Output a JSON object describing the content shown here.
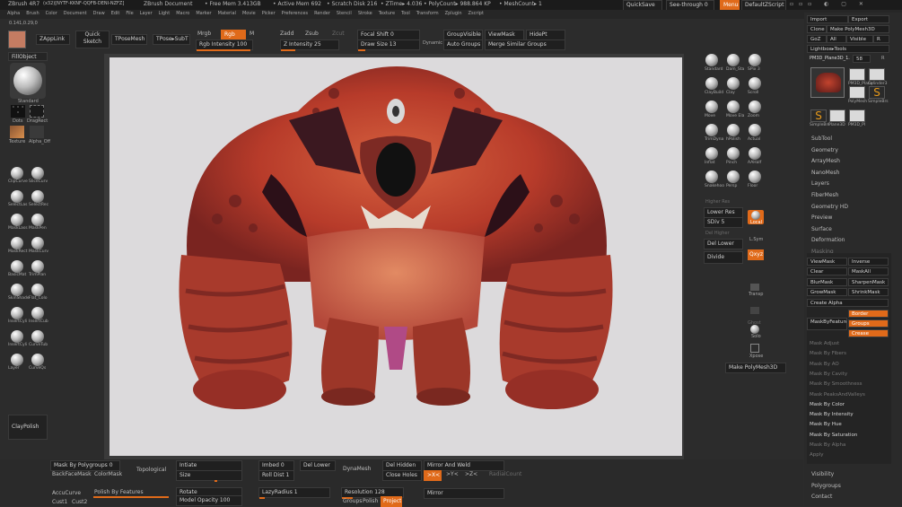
{
  "titlebar": {
    "app": "ZBrush 4R7",
    "build": "(x32)[NYTF-KKNF-QQFB-DENI-NZFZ]",
    "doc": "ZBrush Document",
    "free_mem": "• Free Mem 3.413GB",
    "active_mem": "• Active Mem 692",
    "scratch": "• Scratch Disk 216",
    "ztime": "• ZTime▸ 4.036",
    "polycount": "• PolyCount▸ 988.864 KP",
    "meshcount": "• MeshCount▸ 1",
    "quicksave": "QuickSave",
    "seethrough": "See-through",
    "seethrough_val": "0",
    "menus": "Menus",
    "defaultscript": "DefaultZScript"
  },
  "menubar": [
    "Alpha",
    "Brush",
    "Color",
    "Document",
    "Draw",
    "Edit",
    "File",
    "Layer",
    "Light",
    "Macro",
    "Marker",
    "Material",
    "Movie",
    "Picker",
    "Preferences",
    "Render",
    "Stencil",
    "Stroke",
    "Texture",
    "Tool",
    "Transform",
    "Zplugin",
    "Zscript"
  ],
  "coords": "0.141,0.29,0",
  "toolbar": {
    "zapplink": "ZAppLink",
    "quick_sketch_1": "Quick",
    "quick_sketch_2": "Sketch",
    "tposemesh": "TPoseMesh",
    "tpose_subt": "TPose▸SubT",
    "mrgb": "Mrgb",
    "rgb": "Rgb",
    "m": "M",
    "zadd": "Zadd",
    "zsub": "Zsub",
    "zcut": "Zcut",
    "rgb_intensity": "Rgb Intensity 100",
    "z_intensity": "Z Intensity 25",
    "focal_shift": "Focal Shift 0",
    "draw_size": "Draw Size 13",
    "dynamic": "Dynamic",
    "groupvisible": "GroupVisible",
    "viewmask": "ViewMask",
    "hidept": "HidePt",
    "auto_groups": "Auto Groups",
    "merge_similar": "Merge Similar Groups"
  },
  "left_shelf": {
    "fillobject": "FillObject",
    "standard": "Standard",
    "dots": "Dots",
    "dragrect": "DragRect",
    "texture": "Texture",
    "alpha_off": "Alpha_Off",
    "brushes": [
      "ClipCurve",
      "SliceCurv",
      "SelectLas",
      "SelectRec",
      "MaskLass",
      "MaskPen",
      "MaskRect",
      "MaskCurv",
      "BasicMat",
      "TrimPlan",
      "SkinShade",
      "Flat_Colo",
      "InsertCyli",
      "InsertCub",
      "InsertCyli",
      "CurveTub",
      "Layer",
      "CurveQs"
    ],
    "claypolish": "ClayPolish"
  },
  "right_shelf": {
    "brushes": [
      "Standard",
      "Dam_Sta",
      "SPix 3",
      "ClayBuild",
      "Clay",
      "Scroll",
      "Move",
      "Move Ela",
      "Zoom",
      "TrimDyna",
      "hPolish",
      "Actual",
      "Inflat",
      "Pinch",
      "AAHalf",
      "Snakehoo",
      "Persp",
      "Floor"
    ],
    "higher_res": "Higher Res",
    "lower_res": "Lower Res",
    "sdiv": "SDiv 5",
    "del_higher": "Del Higher",
    "del_lower": "Del Lower",
    "divide": "Divide",
    "local": "Local",
    "lsym": "L.Sym",
    "qxyz": "Qxyz",
    "transp": "Transp",
    "ghost": "Ghost",
    "solo": "Solo",
    "xpose": "Xpose",
    "make_polymesh": "Make PolyMesh3D"
  },
  "tool_panel": {
    "import": "Import",
    "export": "Export",
    "clone": "Clone",
    "make_polymesh": "Make PolyMesh3D",
    "goz": "GoZ",
    "all": "All",
    "visible": "Visible",
    "r": "R",
    "lightbox_tools": "Lightbox▸Tools",
    "current_tool": "PM3D_Plane3D_1.",
    "current_val": "58",
    "tools": [
      "PM3D_Plane",
      "Cylinder3",
      "PolyMesh",
      "SimpleBrs",
      "SimpleBrs",
      "Plane3D",
      "PM3D_Pl"
    ],
    "subpanels": [
      "SubTool",
      "Geometry",
      "ArrayMesh",
      "NanoMesh",
      "Layers",
      "FiberMesh",
      "Geometry HD",
      "Preview",
      "Surface",
      "Deformation",
      "Masking"
    ],
    "masking": {
      "viewmask": "ViewMask",
      "inverse": "Inverse",
      "clear": "Clear",
      "maskall": "MaskAll",
      "blurmask": "BlurMask",
      "sharpenmask": "SharpenMask",
      "growmask": "GrowMask",
      "shrinkmask": "ShrinkMask",
      "create_alpha": "Create Alpha",
      "border": "Border",
      "maskbyfeature": "MaskByFeature",
      "groups": "Groups",
      "crease": "Crease"
    },
    "mask_items": [
      "Mask Adjust",
      "Mask By Fibers",
      "Mask By AO",
      "Mask By Cavity",
      "Mask By Smoothness",
      "Mask PeaksAndValleys",
      "Mask By Color",
      "Mask By Intensity",
      "Mask By Hue",
      "Mask By Saturation",
      "Mask By Alpha",
      "Apply"
    ],
    "bottom": [
      "Visibility",
      "Polygroups",
      "Contact"
    ]
  },
  "bottom_bar": {
    "mask_by_polygroups": "Mask By Polygroups",
    "mask_by_polygroups_val": "0",
    "backfacemask": "BackFaceMask",
    "colormask": "ColorMask",
    "topological": "Topological",
    "intiate": "Intiate",
    "size": "Size",
    "imbed": "Imbed",
    "imbed_val": "0",
    "roll_dist": "Roll Dist",
    "roll_dist_val": "1",
    "del_lower": "Del Lower",
    "dynamesh": "DynaMesh",
    "del_hidden": "Del Hidden",
    "mirror_and_weld": "Mirror And Weld",
    "close_holes": "Close Holes",
    "xyz": ">X<",
    "yy": ">Y<",
    "zz": ">Z<",
    "radialcount": "RadialCount",
    "accucurve": "AccuCurve",
    "polish_by_features": "Polish By Features",
    "rotate": "Rotate",
    "lazyradius": "LazyRadius",
    "lazyradius_val": "1",
    "resolution": "Resolution",
    "resolution_val": "128",
    "mirror": "Mirror",
    "cust1": "Cust1",
    "cust2": "Cust2",
    "model_opacity": "Model Opacity",
    "model_opacity_val": "100",
    "groups": "Groups",
    "polish": "Polish",
    "project": "Project"
  },
  "colors": {
    "accent": "#e06a1a",
    "background": "#2c2c2c",
    "canvas": "#dcdadc",
    "creature": "#c0412c"
  }
}
